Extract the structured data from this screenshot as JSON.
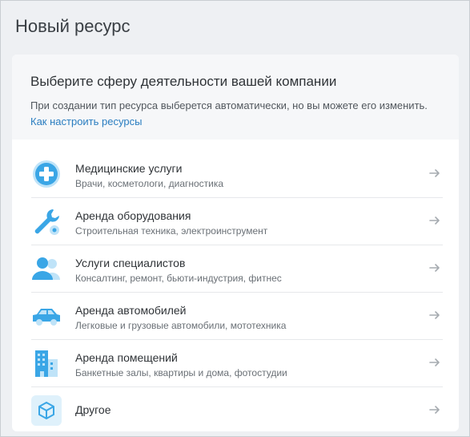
{
  "page": {
    "title": "Новый ресурс"
  },
  "card": {
    "title": "Выберите сферу деятельности вашей компании",
    "description": "При создании тип ресурса выберется автоматически, но вы можете его изменить.",
    "link_label": "Как настроить ресурсы"
  },
  "items": [
    {
      "title": "Медицинские услуги",
      "subtitle": "Врачи, косметологи, диагностика",
      "icon": "medical-cross-icon"
    },
    {
      "title": "Аренда оборудования",
      "subtitle": "Строительная техника, электроинструмент",
      "icon": "wrench-gear-icon"
    },
    {
      "title": "Услуги специалистов",
      "subtitle": "Консалтинг, ремонт, бьюти-индустрия, фитнес",
      "icon": "people-icon"
    },
    {
      "title": "Аренда автомобилей",
      "subtitle": "Легковые и грузовые автомобили, мототехника",
      "icon": "car-icon"
    },
    {
      "title": "Аренда помещений",
      "subtitle": "Банкетные залы, квартиры и дома, фотостудии",
      "icon": "building-icon"
    },
    {
      "title": "Другое",
      "subtitle": "",
      "icon": "cube-icon"
    }
  ],
  "colors": {
    "accent": "#2a7dc0",
    "icon_blue": "#3aa6e6",
    "icon_light": "#bfe3f8"
  }
}
